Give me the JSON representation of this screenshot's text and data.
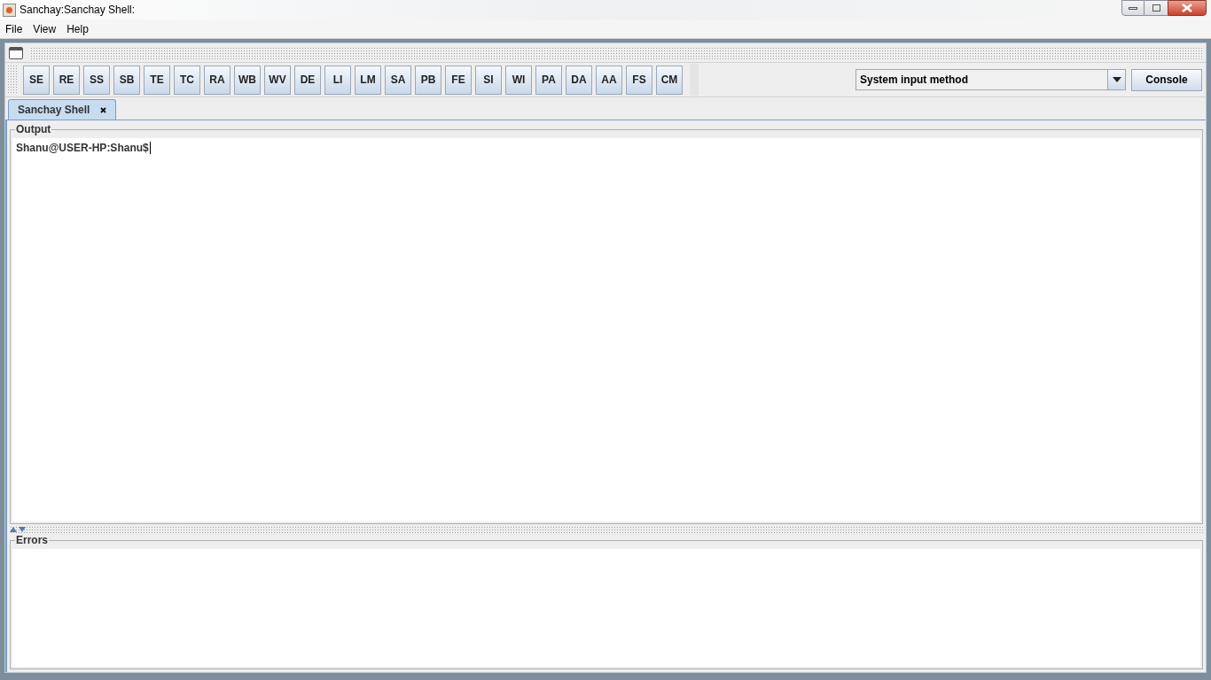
{
  "window": {
    "title": "Sanchay:Sanchay Shell:"
  },
  "menu": [
    "File",
    "View",
    "Help"
  ],
  "toolbar_buttons": [
    "SE",
    "RE",
    "SS",
    "SB",
    "TE",
    "TC",
    "RA",
    "WB",
    "WV",
    "DE",
    "LI",
    "LM",
    "SA",
    "PB",
    "FE",
    "SI",
    "WI",
    "PA",
    "DA",
    "AA",
    "FS",
    "CM"
  ],
  "input_method": {
    "value": "System input method"
  },
  "console_button": "Console",
  "tabs": [
    {
      "label": "Sanchay Shell",
      "selected": true
    }
  ],
  "output": {
    "title": "Output",
    "text": "Shanu@USER-HP:Shanu$"
  },
  "errors": {
    "title": "Errors"
  }
}
